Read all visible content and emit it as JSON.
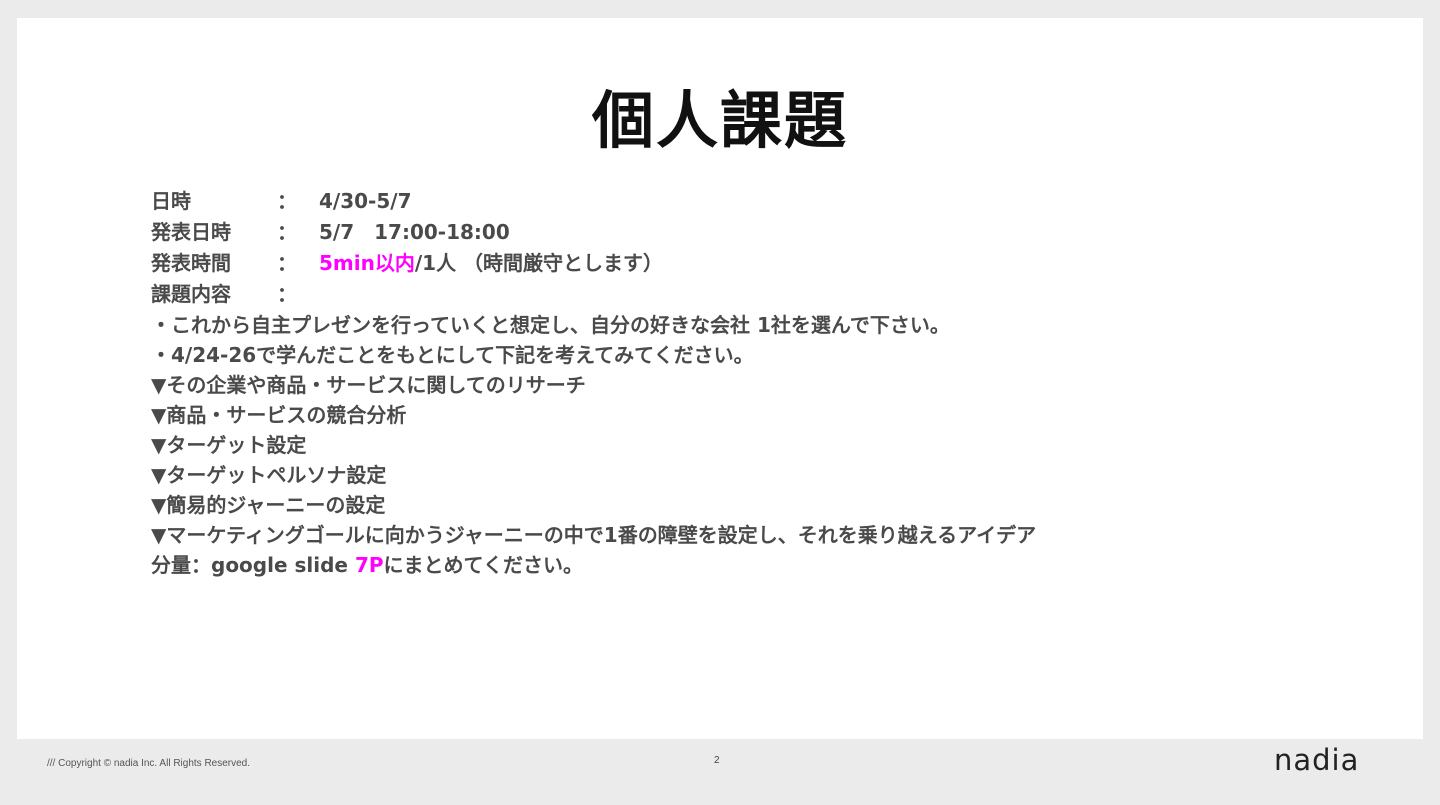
{
  "slide": {
    "title": "個人課題",
    "rows": [
      {
        "label": "日時",
        "colon": "：",
        "value": "4/30-5/7"
      },
      {
        "label": "発表日時",
        "colon": "：",
        "value": "5/7　17:00-18:00"
      },
      {
        "label": "発表時間",
        "colon": "：",
        "value_highlight": "5min以内",
        "value_rest": "/1人 （時間厳守とします）"
      },
      {
        "label": "課題内容",
        "colon": "："
      }
    ],
    "lines": [
      "・これから自主プレゼンを行っていくと想定し、自分の好きな会社 1社を選んで下さい。",
      "・4/24-26で学んだことをもとにして下記を考えてみてください。",
      "▼その企業や商品・サービスに関してのリサーチ",
      "▼商品・サービスの競合分析",
      "▼ターゲット設定",
      "▼ターゲットペルソナ設定",
      "▼簡易的ジャーニーの設定",
      "▼マーケティングゴールに向かうジャーニーの中で1番の障壁を設定し、それを乗り越えるアイデア"
    ],
    "volume": {
      "prefix": "分量：google slide ",
      "highlight": "7P",
      "suffix": "にまとめてください。"
    }
  },
  "footer": {
    "copyright": "/// Copyright © nadia Inc. All Rights Reserved.",
    "page_number": "2",
    "logo": "nadia"
  },
  "colors": {
    "highlight": "#ff00ff",
    "text": "#4a4a4a",
    "background": "#ebebeb"
  }
}
